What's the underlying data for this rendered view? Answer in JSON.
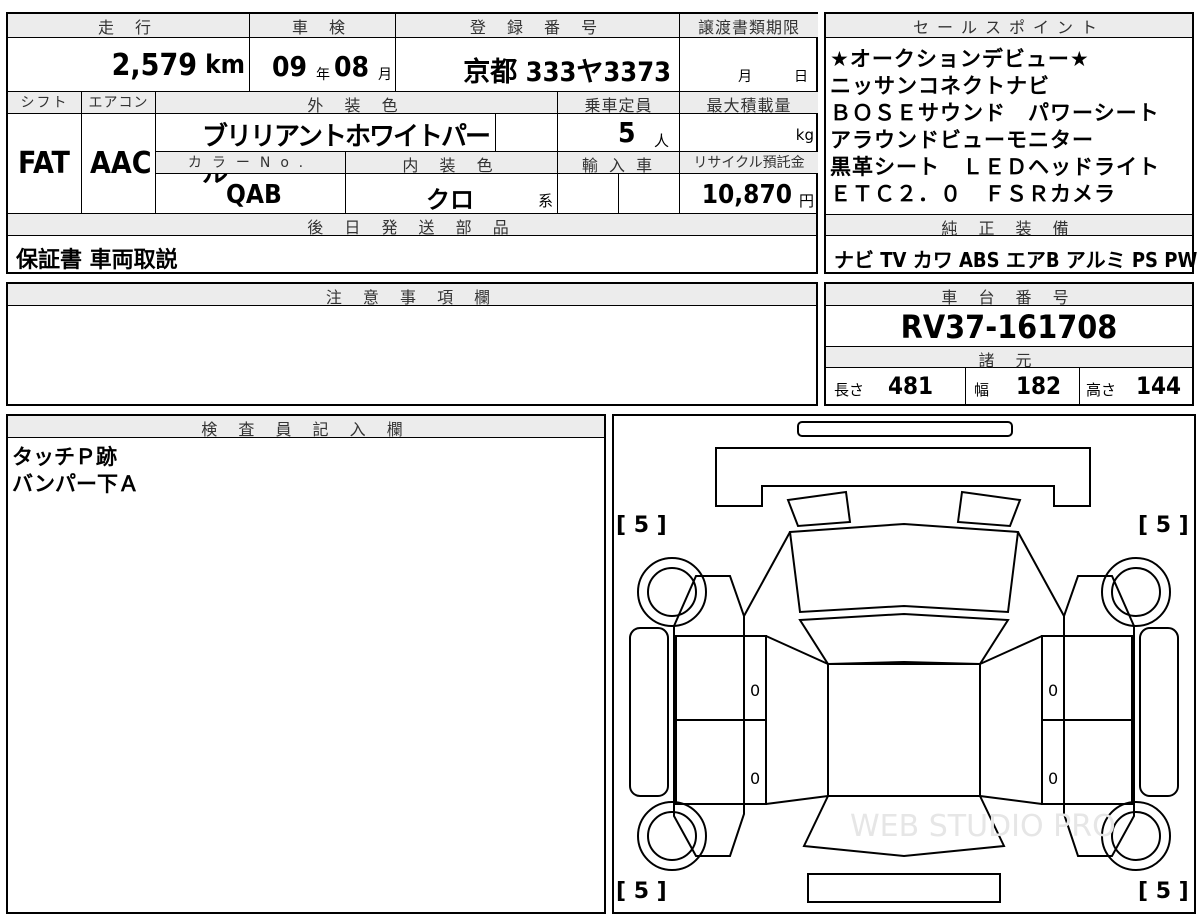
{
  "header": {
    "mileage_label": "走 行",
    "inspection_label": "車 検",
    "registration_label": "登 録 番 号",
    "transfer_deadline_label": "譲渡書類期限",
    "sales_points_label": "セールスポイント"
  },
  "vehicle": {
    "mileage": "2,579",
    "mileage_unit": "km",
    "inspection_year": "09",
    "year_unit": "年",
    "inspection_month": "08",
    "month_unit": "月",
    "registration": "京都 333ヤ3373",
    "deadline_month_unit": "月",
    "deadline_day_unit": "日",
    "shift_label": "シフト",
    "ac_label": "エアコン",
    "exterior_color_label": "外 装 色",
    "capacity_label": "乗車定員",
    "max_load_label": "最大積載量",
    "shift": "FAT",
    "ac": "AAC",
    "exterior_color": "ブリリアントホワイトパール",
    "capacity": "5",
    "capacity_unit": "人",
    "load_unit": "kg",
    "color_no_label": "カラーNo.",
    "interior_color_label": "内 装 色",
    "import_label": "輸 入 車",
    "recycle_label": "リサイクル預託金",
    "color_no": "QAB",
    "interior_color": "クロ",
    "interior_suffix": "系",
    "recycle_fee": "10,870",
    "recycle_unit": "円"
  },
  "sales_points": [
    "★オークションデビュー★",
    "ニッサンコネクトナビ",
    "ＢＯＳＥサウンド　パワーシート",
    "アラウンドビューモニター",
    "黒革シート　ＬＥＤヘッドライト",
    "ＥＴＣ２．０　ＦＳＲカメラ"
  ],
  "later_parts_label": "後 日 発 送 部 品",
  "later_parts": "保証書 車両取説",
  "genuine_equipment_label": "純 正 装 備",
  "genuine_equipment": "ナビ TV カワ ABS エアB アルミ PS PW",
  "notes_label": "注 意 事 項 欄",
  "chassis_label": "車 台 番 号",
  "chassis_number": "RV37-161708",
  "specs_label": "諸 元",
  "dimensions": {
    "length_label": "長さ",
    "length": "481",
    "width_label": "幅",
    "width": "182",
    "height_label": "高さ",
    "height": "144"
  },
  "inspector_label": "検 査 員 記 入 欄",
  "inspector_notes": [
    "タッチＰ跡",
    "バンパー下Ａ"
  ],
  "diagram": {
    "tire_fl": "[ 5 ]",
    "tire_fr": "[ 5 ]",
    "tire_rl": "[ 5 ]",
    "tire_rr": "[ 5 ]",
    "door_mark": "0"
  },
  "watermark": "WEB STUDIO PRO"
}
